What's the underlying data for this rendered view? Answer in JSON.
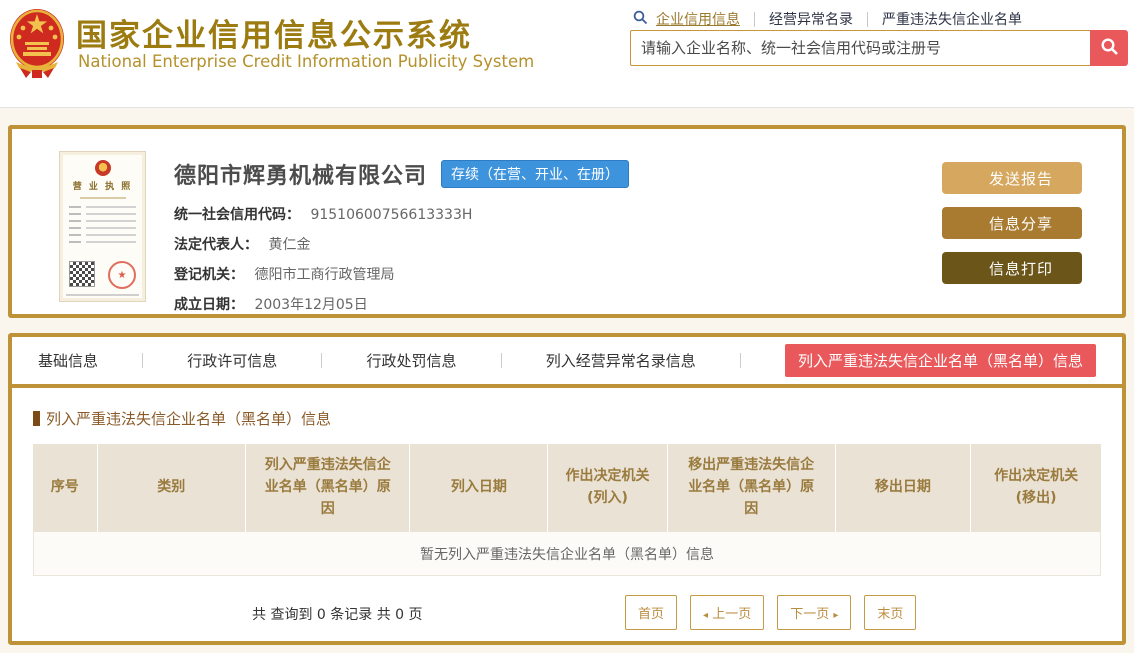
{
  "header": {
    "title_cn": "国家企业信用信息公示系统",
    "title_en": "National Enterprise Credit Information Publicity System",
    "nav": [
      {
        "label": "企业信用信息"
      },
      {
        "label": "经营异常名录"
      },
      {
        "label": "严重违法失信企业名单"
      }
    ],
    "search": {
      "placeholder": "请输入企业名称、统一社会信用代码或注册号"
    }
  },
  "company": {
    "name": "德阳市辉勇机械有限公司",
    "status_badge": "存续（在营、开业、在册）",
    "license_title": "营 业 执 照",
    "fields": [
      {
        "label": "统一社会信用代码：",
        "value": "91510600756613333H"
      },
      {
        "label": "法定代表人：",
        "value": "黄仁金"
      },
      {
        "label": "登记机关：",
        "value": "德阳市工商行政管理局"
      },
      {
        "label": "成立日期：",
        "value": "2003年12月05日"
      }
    ],
    "actions": [
      {
        "label": "发送报告"
      },
      {
        "label": "信息分享"
      },
      {
        "label": "信息打印"
      }
    ]
  },
  "tabs": [
    {
      "label": "基础信息"
    },
    {
      "label": "行政许可信息"
    },
    {
      "label": "行政处罚信息"
    },
    {
      "label": "列入经营异常名录信息"
    },
    {
      "label": "列入严重违法失信企业名单（黑名单）信息"
    }
  ],
  "section": {
    "title": "列入严重违法失信企业名单（黑名单）信息",
    "table_headers": [
      "序号",
      "类别",
      "列入严重违法失信企业名单（黑名单）原因",
      "列入日期",
      "作出决定机关\n(列入)",
      "移出严重违法失信企业名单（黑名单）原因",
      "移出日期",
      "作出决定机关\n(移出)"
    ],
    "empty_text": "暂无列入严重违法失信企业名单（黑名单）信息",
    "pagination": {
      "summary": "共 查询到 0 条记录 共 0 页",
      "first": "首页",
      "prev": "上一页",
      "next": "下一页",
      "last": "末页",
      "prev_arrow": "◂",
      "next_arrow": "▸"
    }
  },
  "colors": {
    "gold_border": "#BE9237",
    "accent_red": "#E9595C",
    "badge_blue": "#3E93DD",
    "title_gold": "#9C7B10",
    "table_header_bg": "#EAE2D5"
  }
}
